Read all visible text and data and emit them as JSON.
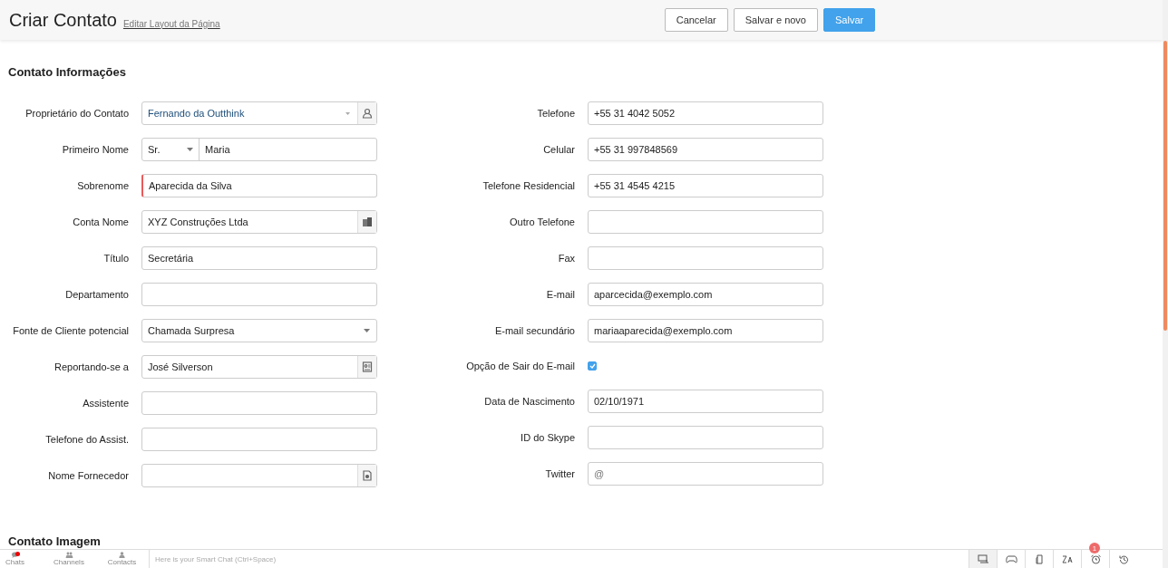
{
  "header": {
    "title": "Criar Contato",
    "layout_link": "Editar Layout da Página",
    "buttons": [
      {
        "label": "Cancelar",
        "kind": "secondary"
      },
      {
        "label": "Salvar e novo",
        "kind": "secondary"
      },
      {
        "label": "Salvar",
        "kind": "primary"
      }
    ]
  },
  "section": {
    "title": "Contato Informações"
  },
  "left_fields": [
    {
      "label": "Proprietário do Contato",
      "kind": "user-lookup",
      "value": "Fernando da Outthink"
    },
    {
      "label": "Primeiro Nome",
      "kind": "salutation",
      "salutation": "Sr.",
      "value": "Maria"
    },
    {
      "label": "Sobrenome",
      "kind": "text",
      "value": "Aparecida da Silva",
      "required": true
    },
    {
      "label": "Conta Nome",
      "kind": "account-lookup",
      "value": "XYZ Construções Ltda"
    },
    {
      "label": "Título",
      "kind": "text",
      "value": "Secretária",
      "required": false
    },
    {
      "label": "Departamento",
      "kind": "text",
      "required": false
    },
    {
      "label": "Fonte de Cliente potencial",
      "kind": "select",
      "value": "Chamada Surpresa"
    },
    {
      "label": "Reportando-se a",
      "kind": "contact-lookup",
      "value": "José Silverson"
    },
    {
      "label": "Assistente",
      "kind": "text",
      "required": false
    },
    {
      "label": "Telefone do Assist.",
      "kind": "text",
      "required": false
    },
    {
      "label": "Nome Fornecedor",
      "kind": "vendor-lookup"
    }
  ],
  "right_fields": [
    {
      "label": "Telefone",
      "kind": "text",
      "value": "+55 31 4042 5052"
    },
    {
      "label": "Celular",
      "kind": "text",
      "value": "+55 31 997848569"
    },
    {
      "label": "Telefone Residencial",
      "kind": "text",
      "value": "+55 31 4545 4215"
    },
    {
      "label": "Outro Telefone",
      "kind": "text"
    },
    {
      "label": "Fax",
      "kind": "text"
    },
    {
      "label": "E-mail",
      "kind": "text",
      "value": "aparcecida@exemplo.com"
    },
    {
      "label": "E-mail secundário",
      "kind": "text",
      "value": "mariaaparecida@exemplo.com"
    },
    {
      "label": "Opção de Sair do E-mail",
      "kind": "checkbox",
      "checked": true
    },
    {
      "label": "Data de Nascimento",
      "kind": "text",
      "value": "02/10/1971"
    },
    {
      "label": "ID do Skype",
      "kind": "text"
    },
    {
      "label": "Twitter",
      "kind": "text",
      "placeholder": "@"
    }
  ],
  "next_section": {
    "title": "Contato Imagem"
  },
  "bottom_bar": {
    "tabs": [
      {
        "label": "Chats",
        "kind": "chats",
        "unread": true
      },
      {
        "label": "Channels",
        "kind": "channels",
        "unread": false
      },
      {
        "label": "Contacts",
        "kind": "contacts",
        "unread": false
      }
    ],
    "chat_placeholder": "Here is your Smart Chat (Ctrl+Space)",
    "tools": [
      {
        "kind": "screen"
      },
      {
        "kind": "gamepad"
      },
      {
        "kind": "note"
      },
      {
        "kind": "translate"
      },
      {
        "kind": "alarm",
        "badge": "1"
      },
      {
        "kind": "history"
      }
    ]
  }
}
